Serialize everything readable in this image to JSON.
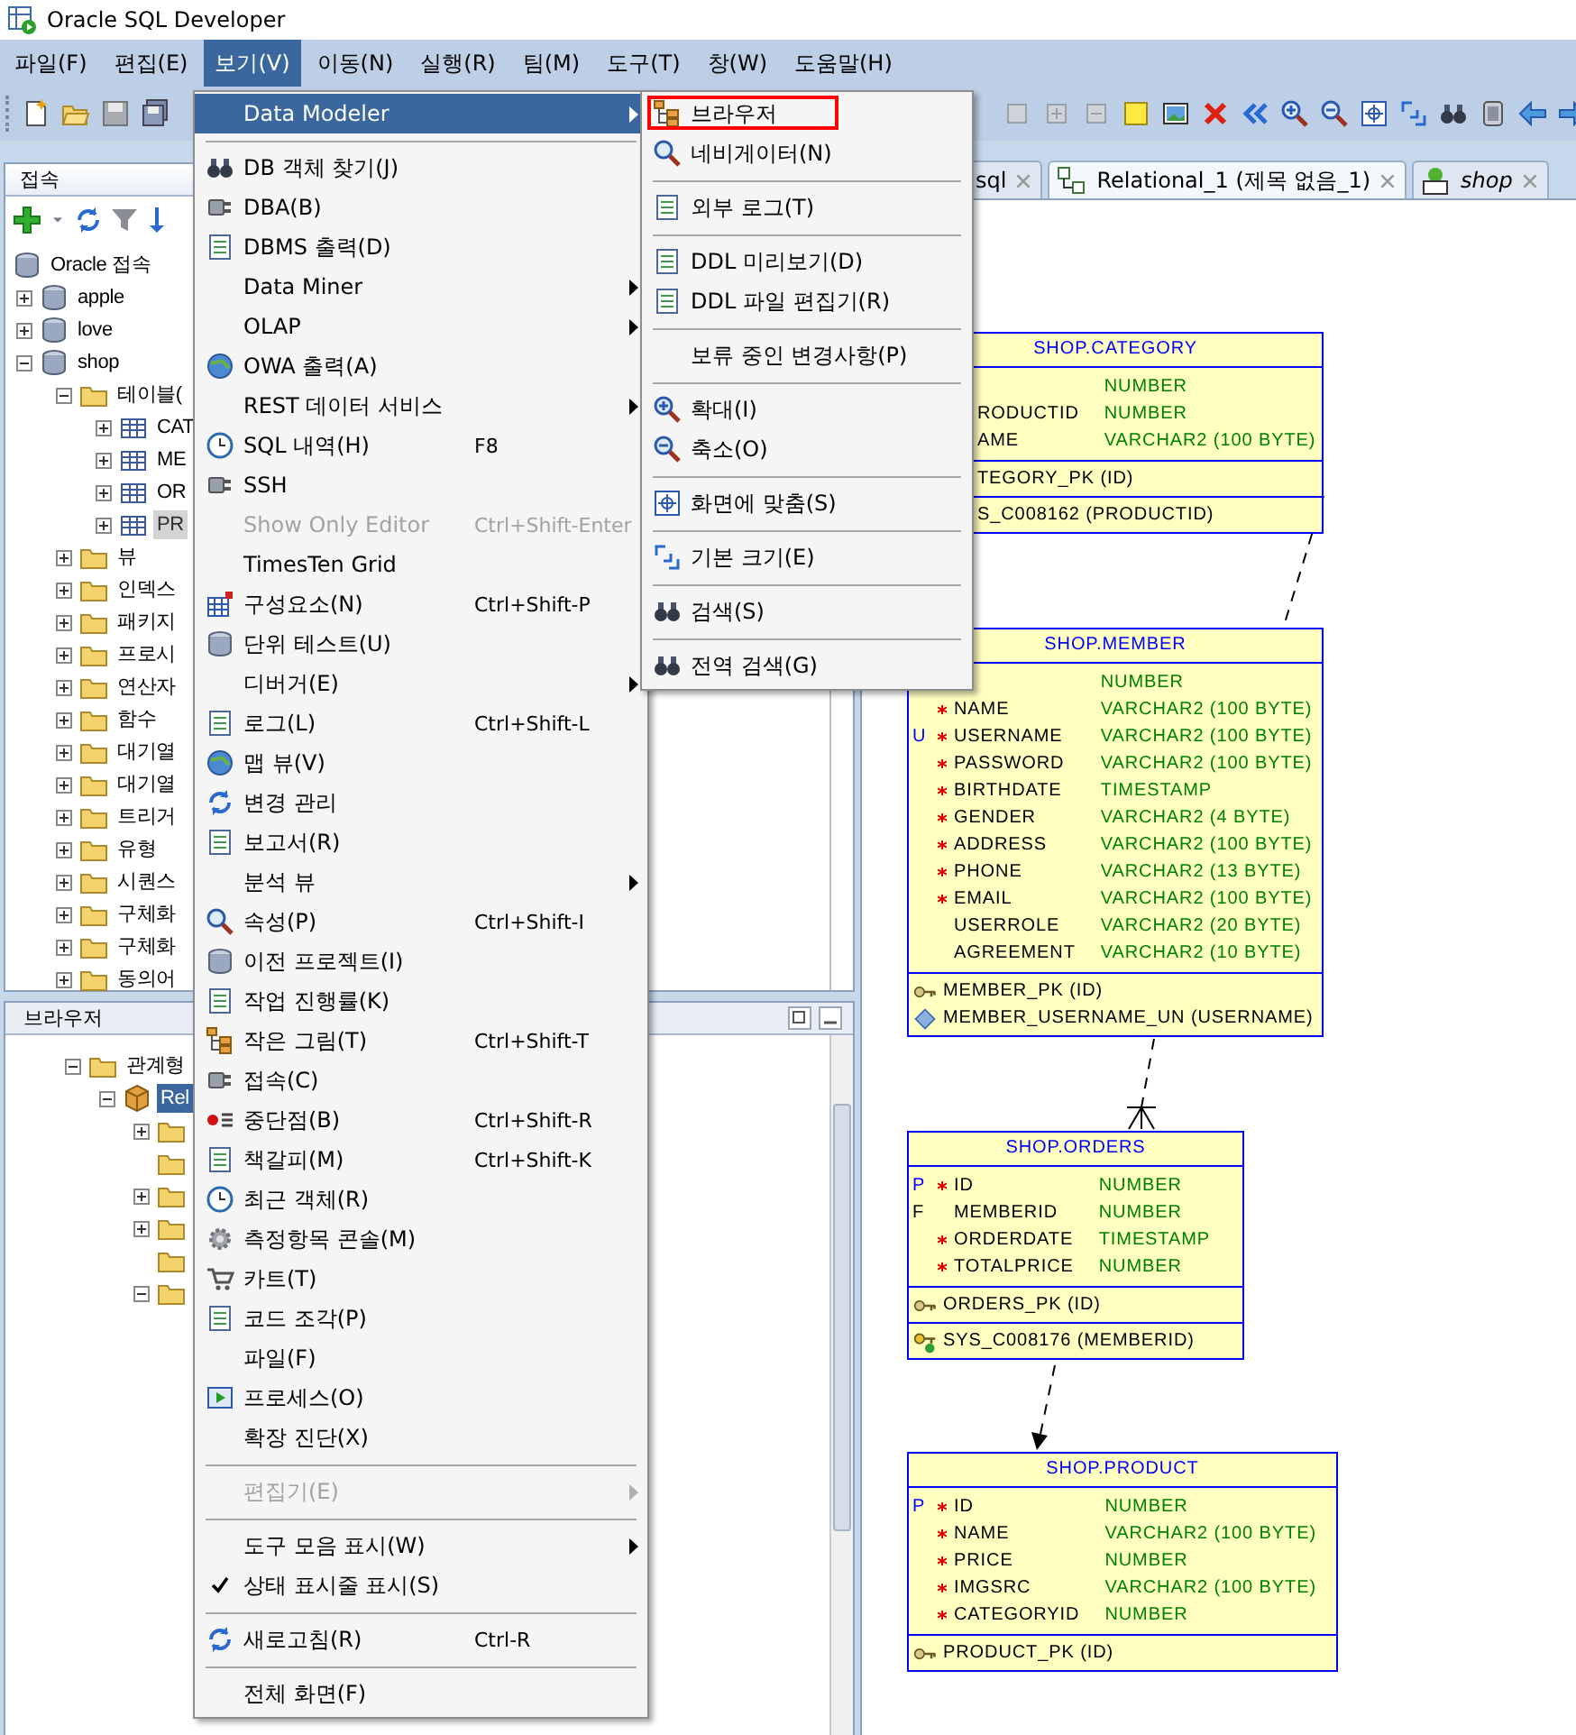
{
  "window": {
    "title": "Oracle SQL Developer"
  },
  "menu_bar": [
    {
      "label": "파일(F)",
      "selected": false
    },
    {
      "label": "편집(E)",
      "selected": false
    },
    {
      "label": "보기(V)",
      "selected": true
    },
    {
      "label": "이동(N)",
      "selected": false
    },
    {
      "label": "실행(R)",
      "selected": false
    },
    {
      "label": "팀(M)",
      "selected": false
    },
    {
      "label": "도구(T)",
      "selected": false
    },
    {
      "label": "창(W)",
      "selected": false
    },
    {
      "label": "도움말(H)",
      "selected": false
    }
  ],
  "connections_panel": {
    "title": "접속",
    "tree": [
      {
        "label": "Oracle 접속",
        "selected": false,
        "children": [
          {
            "label": "apple",
            "expanded": false,
            "selected": false
          },
          {
            "label": "love",
            "expanded": false,
            "selected": false
          },
          {
            "label": "shop",
            "expanded": true,
            "selected": false,
            "children": [
              {
                "label": "테이블(",
                "expanded": true,
                "selected": false,
                "children": [
                  {
                    "label": "CAT",
                    "expanded": false,
                    "selected": false
                  },
                  {
                    "label": "ME",
                    "expanded": false,
                    "selected": false
                  },
                  {
                    "label": "OR",
                    "expanded": false,
                    "selected": false
                  },
                  {
                    "label": "PR",
                    "expanded": false,
                    "selected": true
                  }
                ]
              },
              {
                "label": "뷰",
                "expanded": false,
                "selected": false
              },
              {
                "label": "인덱스",
                "expanded": false,
                "selected": false
              },
              {
                "label": "패키지",
                "expanded": false,
                "selected": false
              },
              {
                "label": "프로시",
                "expanded": false,
                "selected": false
              },
              {
                "label": "연산자",
                "expanded": false,
                "selected": false
              },
              {
                "label": "함수",
                "expanded": false,
                "selected": false
              },
              {
                "label": "대기열",
                "expanded": false,
                "selected": false
              },
              {
                "label": "대기열",
                "expanded": false,
                "selected": false
              },
              {
                "label": "트리거",
                "expanded": false,
                "selected": false
              },
              {
                "label": "유형",
                "expanded": false,
                "selected": false
              },
              {
                "label": "시퀀스",
                "expanded": false,
                "selected": false
              },
              {
                "label": "구체화",
                "expanded": false,
                "selected": false
              },
              {
                "label": "구체화",
                "expanded": false,
                "selected": false
              },
              {
                "label": "동의어",
                "expanded": false,
                "selected": false
              }
            ]
          }
        ]
      }
    ]
  },
  "browser_panel": {
    "title": "브라우저",
    "tree": [
      {
        "label": "관계형",
        "expanded": true,
        "selected": false,
        "children": [
          {
            "label": "Rel",
            "expanded": true,
            "selected": true,
            "children": [
              {
                "expanded": false,
                "selected": false
              },
              {
                "selected": false
              },
              {
                "expanded": false,
                "selected": false
              },
              {
                "expanded": false,
                "selected": false
              },
              {
                "selected": false
              },
              {
                "expanded": true,
                "selected": false
              }
            ]
          }
        ]
      }
    ]
  },
  "editor_tabs": [
    {
      "label": "sql",
      "selected": false
    },
    {
      "label": "Relational_1 (제목 없음_1)",
      "selected": true
    },
    {
      "label": "shop",
      "selected": false
    }
  ],
  "diagram": {
    "tables": [
      {
        "title": "SHOP.CATEGORY",
        "columns": [
          {
            "type": "NUMBER"
          },
          {
            "name": "RODUCTID",
            "type": "NUMBER"
          },
          {
            "name": "AME",
            "type": "VARCHAR2 (100 BYTE)"
          }
        ],
        "key_sections": [
          [
            {
              "label": "TEGORY_PK (ID)"
            }
          ],
          [
            {
              "label": "S_C008162 (PRODUCTID)"
            }
          ]
        ]
      },
      {
        "title": "SHOP.MEMBER",
        "columns": [
          {
            "type": "NUMBER"
          },
          {
            "name": "NAME",
            "type": "VARCHAR2 (100 BYTE)",
            "required": true
          },
          {
            "flag": "U",
            "color": "#0000ff",
            "name": "USERNAME",
            "type": "VARCHAR2 (100 BYTE)",
            "required": true
          },
          {
            "name": "PASSWORD",
            "type": "VARCHAR2 (100 BYTE)",
            "required": true
          },
          {
            "name": "BIRTHDATE",
            "type": "TIMESTAMP",
            "required": true
          },
          {
            "name": "GENDER",
            "type": "VARCHAR2 (4 BYTE)",
            "required": true
          },
          {
            "name": "ADDRESS",
            "type": "VARCHAR2 (100 BYTE)",
            "required": true
          },
          {
            "name": "PHONE",
            "type": "VARCHAR2 (13 BYTE)",
            "required": true
          },
          {
            "name": "EMAIL",
            "type": "VARCHAR2 (100 BYTE)",
            "required": true
          },
          {
            "name": "USERROLE",
            "type": "VARCHAR2 (20 BYTE)",
            "required": false
          },
          {
            "name": "AGREEMENT",
            "type": "VARCHAR2 (10 BYTE)",
            "required": false
          }
        ],
        "key_sections": [
          [
            {
              "kind": "primary",
              "label": "MEMBER_PK (ID)"
            },
            {
              "kind": "unique",
              "label": "MEMBER_USERNAME_UN (USERNAME)"
            }
          ]
        ]
      },
      {
        "title": "SHOP.ORDERS",
        "columns": [
          {
            "flag": "P",
            "color": "#0000ff",
            "name": "ID",
            "type": "NUMBER",
            "required": true
          },
          {
            "flag": "F",
            "color": "#000000",
            "name": "MEMBERID",
            "type": "NUMBER",
            "required": false
          },
          {
            "name": "ORDERDATE",
            "type": "TIMESTAMP",
            "required": true
          },
          {
            "name": "TOTALPRICE",
            "type": "NUMBER",
            "required": true
          }
        ],
        "key_sections": [
          [
            {
              "kind": "primary",
              "label": "ORDERS_PK (ID)"
            }
          ],
          [
            {
              "kind": "foreign",
              "label": "SYS_C008176 (MEMBERID)"
            }
          ]
        ]
      },
      {
        "title": "SHOP.PRODUCT",
        "columns": [
          {
            "flag": "P",
            "color": "#0000ff",
            "name": "ID",
            "type": "NUMBER",
            "required": true
          },
          {
            "name": "NAME",
            "type": "VARCHAR2 (100 BYTE)",
            "required": true
          },
          {
            "name": "PRICE",
            "type": "NUMBER",
            "required": true
          },
          {
            "name": "IMGSRC",
            "type": "VARCHAR2 (100 BYTE)",
            "required": true
          },
          {
            "name": "CATEGORYID",
            "type": "NUMBER",
            "required": true
          }
        ],
        "key_sections": [
          [
            {
              "kind": "primary",
              "label": "PRODUCT_PK (ID)"
            }
          ]
        ]
      }
    ]
  },
  "view_menu": {
    "items": [
      {
        "kind": "item",
        "label": "Data Modeler",
        "submenu": true,
        "disabled": false,
        "checked": false,
        "selected": true
      },
      {
        "kind": "separator"
      },
      {
        "kind": "item",
        "label": "DB 객체 찾기(J)",
        "submenu": false,
        "disabled": false,
        "checked": false,
        "selected": false
      },
      {
        "kind": "item",
        "label": "DBA(B)",
        "submenu": false,
        "disabled": false,
        "checked": false,
        "selected": false
      },
      {
        "kind": "item",
        "label": "DBMS 출력(D)",
        "submenu": false,
        "disabled": false,
        "checked": false,
        "selected": false
      },
      {
        "kind": "item",
        "label": "Data Miner",
        "submenu": true,
        "disabled": false,
        "checked": false,
        "selected": false
      },
      {
        "kind": "item",
        "label": "OLAP",
        "submenu": true,
        "disabled": false,
        "checked": false,
        "selected": false
      },
      {
        "kind": "item",
        "label": "OWA 출력(A)",
        "submenu": false,
        "disabled": false,
        "checked": false,
        "selected": false
      },
      {
        "kind": "item",
        "label": "REST 데이터 서비스",
        "submenu": true,
        "disabled": false,
        "checked": false,
        "selected": false
      },
      {
        "kind": "item",
        "label": "SQL 내역(H)",
        "shortcut": "F8",
        "submenu": false,
        "disabled": false,
        "checked": false,
        "selected": false
      },
      {
        "kind": "item",
        "label": "SSH",
        "submenu": false,
        "disabled": false,
        "checked": false,
        "selected": false
      },
      {
        "kind": "item",
        "label": "Show Only Editor",
        "shortcut": "Ctrl+Shift-Enter",
        "submenu": false,
        "disabled": true,
        "checked": false,
        "selected": false
      },
      {
        "kind": "item",
        "label": "TimesTen Grid",
        "submenu": false,
        "disabled": false,
        "checked": false,
        "selected": false
      },
      {
        "kind": "item",
        "label": "구성요소(N)",
        "shortcut": "Ctrl+Shift-P",
        "submenu": false,
        "disabled": false,
        "checked": false,
        "selected": false
      },
      {
        "kind": "item",
        "label": "단위 테스트(U)",
        "submenu": false,
        "disabled": false,
        "checked": false,
        "selected": false
      },
      {
        "kind": "item",
        "label": "디버거(E)",
        "submenu": true,
        "disabled": false,
        "checked": false,
        "selected": false
      },
      {
        "kind": "item",
        "label": "로그(L)",
        "shortcut": "Ctrl+Shift-L",
        "submenu": false,
        "disabled": false,
        "checked": false,
        "selected": false
      },
      {
        "kind": "item",
        "label": "맵 뷰(V)",
        "submenu": false,
        "disabled": false,
        "checked": false,
        "selected": false
      },
      {
        "kind": "item",
        "label": "변경 관리",
        "submenu": false,
        "disabled": false,
        "checked": false,
        "selected": false
      },
      {
        "kind": "item",
        "label": "보고서(R)",
        "submenu": false,
        "disabled": false,
        "checked": false,
        "selected": false
      },
      {
        "kind": "item",
        "label": "분석 뷰",
        "submenu": true,
        "disabled": false,
        "checked": false,
        "selected": false
      },
      {
        "kind": "item",
        "label": "속성(P)",
        "shortcut": "Ctrl+Shift-I",
        "submenu": false,
        "disabled": false,
        "checked": false,
        "selected": false
      },
      {
        "kind": "item",
        "label": "이전 프로젝트(I)",
        "submenu": false,
        "disabled": false,
        "checked": false,
        "selected": false
      },
      {
        "kind": "item",
        "label": "작업 진행률(K)",
        "submenu": false,
        "disabled": false,
        "checked": false,
        "selected": false
      },
      {
        "kind": "item",
        "label": "작은 그림(T)",
        "shortcut": "Ctrl+Shift-T",
        "submenu": false,
        "disabled": false,
        "checked": false,
        "selected": false
      },
      {
        "kind": "item",
        "label": "접속(C)",
        "submenu": false,
        "disabled": false,
        "checked": false,
        "selected": false
      },
      {
        "kind": "item",
        "label": "중단점(B)",
        "shortcut": "Ctrl+Shift-R",
        "submenu": false,
        "disabled": false,
        "checked": false,
        "selected": false
      },
      {
        "kind": "item",
        "label": "책갈피(M)",
        "shortcut": "Ctrl+Shift-K",
        "submenu": false,
        "disabled": false,
        "checked": false,
        "selected": false
      },
      {
        "kind": "item",
        "label": "최근 객체(R)",
        "submenu": false,
        "disabled": false,
        "checked": false,
        "selected": false
      },
      {
        "kind": "item",
        "label": "측정항목 콘솔(M)",
        "submenu": false,
        "disabled": false,
        "checked": false,
        "selected": false
      },
      {
        "kind": "item",
        "label": "카트(T)",
        "submenu": false,
        "disabled": false,
        "checked": false,
        "selected": false
      },
      {
        "kind": "item",
        "label": "코드 조각(P)",
        "submenu": false,
        "disabled": false,
        "checked": false,
        "selected": false
      },
      {
        "kind": "item",
        "label": "파일(F)",
        "submenu": false,
        "disabled": false,
        "checked": false,
        "selected": false
      },
      {
        "kind": "item",
        "label": "프로세스(O)",
        "submenu": false,
        "disabled": false,
        "checked": false,
        "selected": false
      },
      {
        "kind": "item",
        "label": "확장 진단(X)",
        "submenu": false,
        "disabled": false,
        "checked": false,
        "selected": false
      },
      {
        "kind": "separator"
      },
      {
        "kind": "item",
        "label": "편집기(E)",
        "submenu": true,
        "disabled": true,
        "checked": false,
        "selected": false
      },
      {
        "kind": "separator"
      },
      {
        "kind": "item",
        "label": "도구 모음 표시(W)",
        "submenu": true,
        "disabled": false,
        "checked": false,
        "selected": false
      },
      {
        "kind": "item",
        "label": "상태 표시줄 표시(S)",
        "submenu": false,
        "disabled": false,
        "checked": true,
        "selected": false
      },
      {
        "kind": "separator"
      },
      {
        "kind": "item",
        "label": "새로고침(R)",
        "shortcut": "Ctrl-R",
        "submenu": false,
        "disabled": false,
        "checked": false,
        "selected": false
      },
      {
        "kind": "separator"
      },
      {
        "kind": "item",
        "label": "전체 화면(F)",
        "submenu": false,
        "disabled": false,
        "checked": false,
        "selected": false
      }
    ]
  },
  "data_modeler_submenu": {
    "items": [
      {
        "kind": "item",
        "label": "브라우저",
        "outlined": true,
        "selected": false
      },
      {
        "kind": "item",
        "label": "네비게이터(N)",
        "outlined": false,
        "selected": false
      },
      {
        "kind": "separator"
      },
      {
        "kind": "item",
        "label": "외부 로그(T)",
        "outlined": false,
        "selected": false
      },
      {
        "kind": "separator"
      },
      {
        "kind": "item",
        "label": "DDL 미리보기(D)",
        "outlined": false,
        "selected": false
      },
      {
        "kind": "item",
        "label": "DDL 파일 편집기(R)",
        "outlined": false,
        "selected": false
      },
      {
        "kind": "separator"
      },
      {
        "kind": "item",
        "label": "보류 중인 변경사항(P)",
        "outlined": false,
        "selected": false
      },
      {
        "kind": "separator"
      },
      {
        "kind": "item",
        "label": "확대(I)",
        "outlined": false,
        "selected": false
      },
      {
        "kind": "item",
        "label": "축소(O)",
        "outlined": false,
        "selected": false
      },
      {
        "kind": "separator"
      },
      {
        "kind": "item",
        "label": "화면에 맞춤(S)",
        "outlined": false,
        "selected": false
      },
      {
        "kind": "separator"
      },
      {
        "kind": "item",
        "label": "기본 크기(E)",
        "outlined": false,
        "selected": false
      },
      {
        "kind": "separator"
      },
      {
        "kind": "item",
        "label": "검색(S)",
        "outlined": false,
        "selected": false
      },
      {
        "kind": "separator"
      },
      {
        "kind": "item",
        "label": "전역 검색(G)",
        "outlined": false,
        "selected": false
      }
    ]
  }
}
